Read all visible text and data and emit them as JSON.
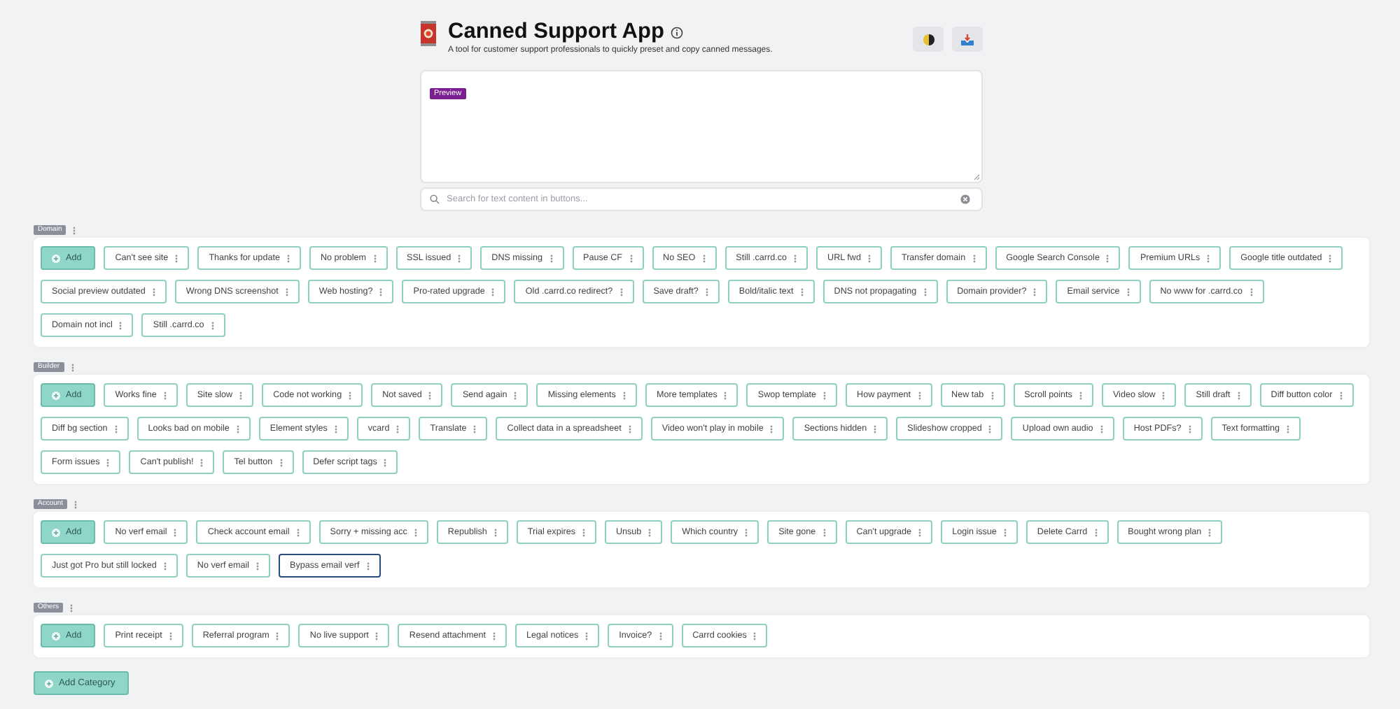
{
  "app": {
    "title": "Canned Support App",
    "subtitle": "A tool for customer support professionals to quickly preset and copy canned messages."
  },
  "preview": {
    "badge": "Preview"
  },
  "search": {
    "placeholder": "Search for text content in buttons..."
  },
  "categories": [
    {
      "name": "Domain",
      "add_label": "Add",
      "buttons": [
        {
          "label": "Can't see site",
          "focused": false
        },
        {
          "label": "Thanks for update",
          "focused": false
        },
        {
          "label": "No problem",
          "focused": false
        },
        {
          "label": "SSL issued",
          "focused": false
        },
        {
          "label": "DNS missing",
          "focused": false
        },
        {
          "label": "Pause CF",
          "focused": false
        },
        {
          "label": "No SEO",
          "focused": false
        },
        {
          "label": "Still .carrd.co",
          "focused": false
        },
        {
          "label": "URL fwd",
          "focused": false
        },
        {
          "label": "Transfer domain",
          "focused": false
        },
        {
          "label": "Google Search Console",
          "focused": false
        },
        {
          "label": "Premium URLs",
          "focused": false
        },
        {
          "label": "Google title outdated",
          "focused": false
        },
        {
          "label": "Social preview outdated",
          "focused": false
        },
        {
          "label": "Wrong DNS screenshot",
          "focused": false
        },
        {
          "label": "Web hosting?",
          "focused": false
        },
        {
          "label": "Pro-rated upgrade",
          "focused": false
        },
        {
          "label": "Old .carrd.co redirect?",
          "focused": false
        },
        {
          "label": "Save draft?",
          "focused": false
        },
        {
          "label": "Bold/italic text",
          "focused": false
        },
        {
          "label": "DNS not propagating",
          "focused": false
        },
        {
          "label": "Domain provider?",
          "focused": false
        },
        {
          "label": "Email service",
          "focused": false
        },
        {
          "label": "No www for .carrd.co",
          "focused": false
        },
        {
          "label": "Domain not incl",
          "focused": false
        },
        {
          "label": "Still .carrd.co",
          "focused": false
        }
      ]
    },
    {
      "name": "Builder",
      "add_label": "Add",
      "buttons": [
        {
          "label": "Works fine",
          "focused": false
        },
        {
          "label": "Site slow",
          "focused": false
        },
        {
          "label": "Code not working",
          "focused": false
        },
        {
          "label": "Not saved",
          "focused": false
        },
        {
          "label": "Send again",
          "focused": false
        },
        {
          "label": "Missing elements",
          "focused": false
        },
        {
          "label": "More templates",
          "focused": false
        },
        {
          "label": "Swop template",
          "focused": false
        },
        {
          "label": "How payment",
          "focused": false
        },
        {
          "label": "New tab",
          "focused": false
        },
        {
          "label": "Scroll points",
          "focused": false
        },
        {
          "label": "Video slow",
          "focused": false
        },
        {
          "label": "Still draft",
          "focused": false
        },
        {
          "label": "Diff button color",
          "focused": false
        },
        {
          "label": "Diff bg section",
          "focused": false
        },
        {
          "label": "Looks bad on mobile",
          "focused": false
        },
        {
          "label": "Element styles",
          "focused": false
        },
        {
          "label": "vcard",
          "focused": false
        },
        {
          "label": "Translate",
          "focused": false
        },
        {
          "label": "Collect data in a spreadsheet",
          "focused": false
        },
        {
          "label": "Video won't play in mobile",
          "focused": false
        },
        {
          "label": "Sections hidden",
          "focused": false
        },
        {
          "label": "Slideshow cropped",
          "focused": false
        },
        {
          "label": "Upload own audio",
          "focused": false
        },
        {
          "label": "Host PDFs?",
          "focused": false
        },
        {
          "label": "Text formatting",
          "focused": false
        },
        {
          "label": "Form issues",
          "focused": false
        },
        {
          "label": "Can't publish!",
          "focused": false
        },
        {
          "label": "Tel button",
          "focused": false
        },
        {
          "label": "Defer script tags",
          "focused": false
        }
      ]
    },
    {
      "name": "Account",
      "add_label": "Add",
      "buttons": [
        {
          "label": "No verf email",
          "focused": false
        },
        {
          "label": "Check account email",
          "focused": false
        },
        {
          "label": "Sorry + missing acc",
          "focused": false
        },
        {
          "label": "Republish",
          "focused": false
        },
        {
          "label": "Trial expires",
          "focused": false
        },
        {
          "label": "Unsub",
          "focused": false
        },
        {
          "label": "Which country",
          "focused": false
        },
        {
          "label": "Site gone",
          "focused": false
        },
        {
          "label": "Can't upgrade",
          "focused": false
        },
        {
          "label": "Login issue",
          "focused": false
        },
        {
          "label": "Delete Carrd",
          "focused": false
        },
        {
          "label": "Bought wrong plan",
          "focused": false
        },
        {
          "label": "Just got Pro but still locked",
          "focused": false
        },
        {
          "label": "No verf email",
          "focused": false
        },
        {
          "label": "Bypass email verf",
          "focused": true
        }
      ]
    },
    {
      "name": "Others",
      "add_label": "Add",
      "buttons": [
        {
          "label": "Print receipt",
          "focused": false
        },
        {
          "label": "Referral program",
          "focused": false
        },
        {
          "label": "No live support",
          "focused": false
        },
        {
          "label": "Resend attachment",
          "focused": false
        },
        {
          "label": "Legal notices",
          "focused": false
        },
        {
          "label": "Invoice?",
          "focused": false
        },
        {
          "label": "Carrd cookies",
          "focused": false
        }
      ]
    }
  ],
  "add_category": "Add Category"
}
